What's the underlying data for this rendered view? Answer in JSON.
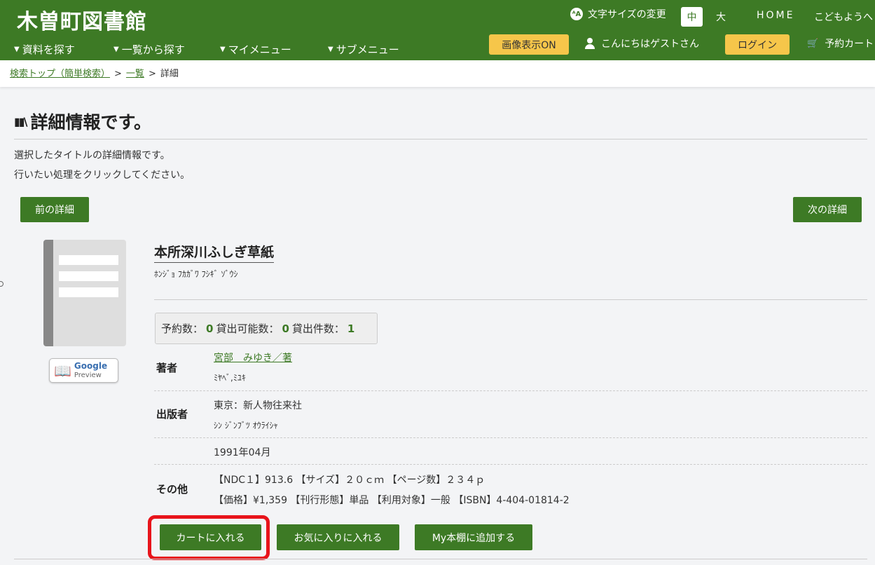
{
  "header": {
    "site_title": "木曽町図書館",
    "nav": [
      "資料を探す",
      "一覧から探す",
      "マイメニュー",
      "サブメニュー"
    ],
    "font_size_label": "文字サイズの変更",
    "font_size_icon": "ᴬA",
    "font_mid": "中",
    "font_large": "大",
    "home": "HOME",
    "kids": "こどもようへ",
    "image_toggle": "画像表示ON",
    "greeting": "こんにちはゲストさん",
    "login": "ログイン",
    "cart": "予約カート"
  },
  "breadcrumb": {
    "top": "検索トップ（簡単検索）",
    "list": "一覧",
    "current": "詳細",
    "sep": ">"
  },
  "page": {
    "title": "詳細情報です。",
    "desc1": "選択したタイトルの詳細情報です。",
    "desc2": "行いたい処理をクリックしてください。",
    "prev": "前の詳細",
    "next": "次の詳細"
  },
  "preview": {
    "google": "Google",
    "preview": "Preview"
  },
  "book": {
    "title": "本所深川ふしぎ草紙",
    "kana": "ﾎﾝｼﾞｮ ﾌｶｶﾞﾜ ﾌｼｷﾞ ｿﾞｳｼ",
    "counts": {
      "reserve_label": "予約数：",
      "reserve": "0",
      "available_label": "貸出可能数：",
      "available": "0",
      "loans_label": "貸出件数：",
      "loans": "1"
    },
    "author_label": "著者",
    "author": "宮部　みゆき／著",
    "author_kana": "ﾐﾔﾍﾞ,ﾐﾕｷ",
    "publisher_label": "出版者",
    "publisher": "東京：新人物往来社",
    "publisher_kana": "ｼﾝ ｼﾞﾝﾌﾞﾂ ｵｳﾗｲｼｬ",
    "date": "1991年04月",
    "other_label": "その他",
    "other1": "【NDC１】913.6 【サイズ】２０ｃｍ 【ページ数】２３４ｐ",
    "other2": "【価格】¥1,359 【刊行形態】単品 【利用対象】一般 【ISBN】4-404-01814-2"
  },
  "actions": {
    "cart": "カートに入れる",
    "fav": "お気に入りに入れる",
    "shelf": "My本棚に追加する"
  }
}
